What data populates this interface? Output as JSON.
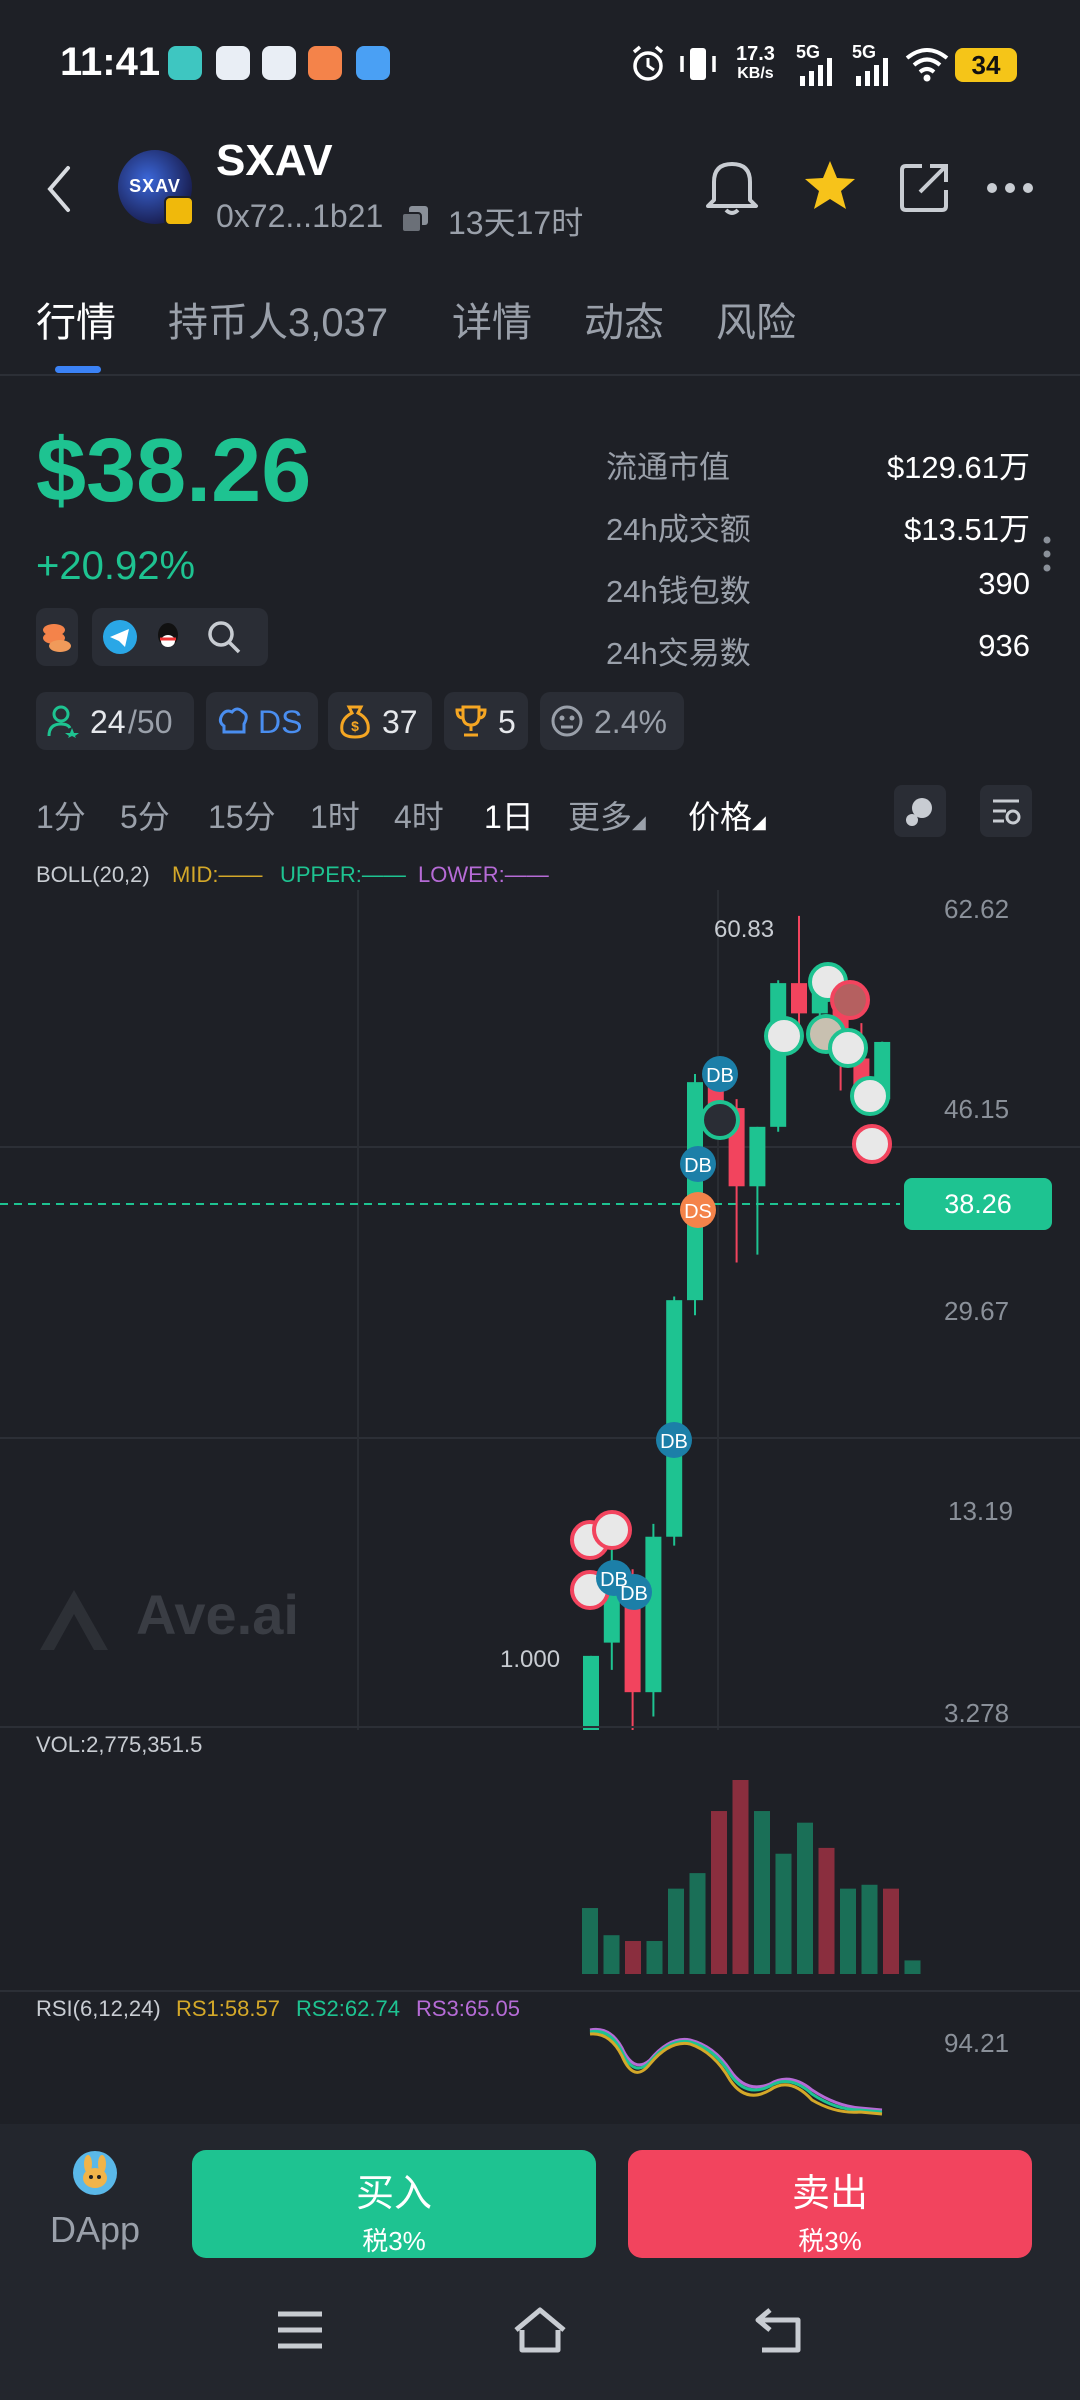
{
  "status_bar": {
    "time": "11:41",
    "net_speed_value": "17.3",
    "net_speed_unit": "KB/s",
    "signal_1": "5G",
    "signal_2": "5G",
    "battery": "34",
    "app_icons": [
      "aave-icon",
      "at-icon",
      "telegram-icon",
      "chat-icon",
      "browser-icon"
    ]
  },
  "header": {
    "back_icon": "chevron-left-icon",
    "token_name": "SXAV",
    "avatar_text": "SXAV",
    "address": "0x72...1b21",
    "age": "13天17时",
    "actions": [
      "bell-icon",
      "star-icon",
      "share-icon",
      "more-icon"
    ]
  },
  "tabs": [
    {
      "label": "行情",
      "active": true
    },
    {
      "label": "持币人3,037",
      "active": false
    },
    {
      "label": "详情",
      "active": false
    },
    {
      "label": "动态",
      "active": false
    },
    {
      "label": "风险",
      "active": false
    }
  ],
  "price": {
    "value": "$38.26",
    "change": "+20.92%"
  },
  "stats": [
    {
      "label": "流通市值",
      "value": "$129.61万"
    },
    {
      "label": "24h成交额",
      "value": "$13.51万"
    },
    {
      "label": "24h钱包数",
      "value": "390"
    },
    {
      "label": "24h交易数",
      "value": "936"
    }
  ],
  "badges": {
    "holders": "24",
    "holders_total": "/50",
    "dev": "DS",
    "money": "37",
    "trophy": "5",
    "risk": "2.4%"
  },
  "timeframes": [
    {
      "label": "1分",
      "active": false
    },
    {
      "label": "5分",
      "active": false
    },
    {
      "label": "15分",
      "active": false
    },
    {
      "label": "1时",
      "active": false
    },
    {
      "label": "4时",
      "active": false
    },
    {
      "label": "1日",
      "active": true
    }
  ],
  "more_label": "更多",
  "price_mode_label": "价格",
  "boll": {
    "title": "BOLL(20,2)",
    "mid": "MID:——",
    "upper": "UPPER:——",
    "lower": "LOWER:——",
    "mid_color": "#d4a829",
    "upper_color": "#1ec391",
    "lower_color": "#b66bd6"
  },
  "watermark": "Ave.ai",
  "chart_data": {
    "type": "candlestick",
    "y_axis_ticks": [
      "62.62",
      "46.15",
      "38.26",
      "29.67",
      "13.19",
      "3.278"
    ],
    "current_price": "38.26",
    "high_label": "60.83",
    "low_label": "1.000",
    "candles": [
      {
        "o": 2.5,
        "h": 4.0,
        "l": 1.0,
        "c": 4.0
      },
      {
        "o": 4.2,
        "h": 6.0,
        "l": 3.8,
        "c": 5.0
      },
      {
        "o": 5.0,
        "h": 5.5,
        "l": 3.0,
        "c": 3.5
      },
      {
        "o": 3.5,
        "h": 6.5,
        "l": 3.2,
        "c": 6.2
      },
      {
        "o": 6.2,
        "h": 15.0,
        "l": 6.0,
        "c": 14.8
      },
      {
        "o": 14.8,
        "h": 34.0,
        "l": 14.0,
        "c": 33.0
      },
      {
        "o": 33.0,
        "h": 34.0,
        "l": 28.0,
        "c": 30.0
      },
      {
        "o": 30.0,
        "h": 31.0,
        "l": 17.0,
        "c": 22.5
      },
      {
        "o": 22.5,
        "h": 28.0,
        "l": 17.5,
        "c": 28.0
      },
      {
        "o": 28.0,
        "h": 48.0,
        "l": 27.5,
        "c": 47.5
      },
      {
        "o": 47.5,
        "h": 60.83,
        "l": 40.0,
        "c": 42.5
      },
      {
        "o": 42.5,
        "h": 46.5,
        "l": 38.0,
        "c": 46.0
      },
      {
        "o": 46.0,
        "h": 49.0,
        "l": 32.0,
        "c": 36.0
      },
      {
        "o": 36.0,
        "h": 41.0,
        "l": 30.0,
        "c": 31.0
      },
      {
        "o": 31.0,
        "h": 38.3,
        "l": 30.5,
        "c": 38.26
      }
    ],
    "volume_title": "VOL:2,775,351.5",
    "volume": [
      0.34,
      0.2,
      0.17,
      0.17,
      0.44,
      0.52,
      0.84,
      1.0,
      0.84,
      0.62,
      0.78,
      0.65,
      0.44,
      0.46,
      0.44,
      0.07
    ],
    "rsi": {
      "title": "RSI(6,12,24)",
      "rs1": "RS1:58.57",
      "rs2": "RS2:62.74",
      "rs3": "RS3:65.05",
      "axis_label": "94.21",
      "rs1_color": "#d4a829",
      "rs2_color": "#1ec391",
      "rs3_color": "#b66bd6"
    }
  },
  "bottom": {
    "dapp_label": "DApp",
    "buy_label": "买入",
    "buy_tax": "税3%",
    "sell_label": "卖出",
    "sell_tax": "税3%",
    "buy_color": "#1ec391",
    "sell_color": "#f2445e"
  }
}
